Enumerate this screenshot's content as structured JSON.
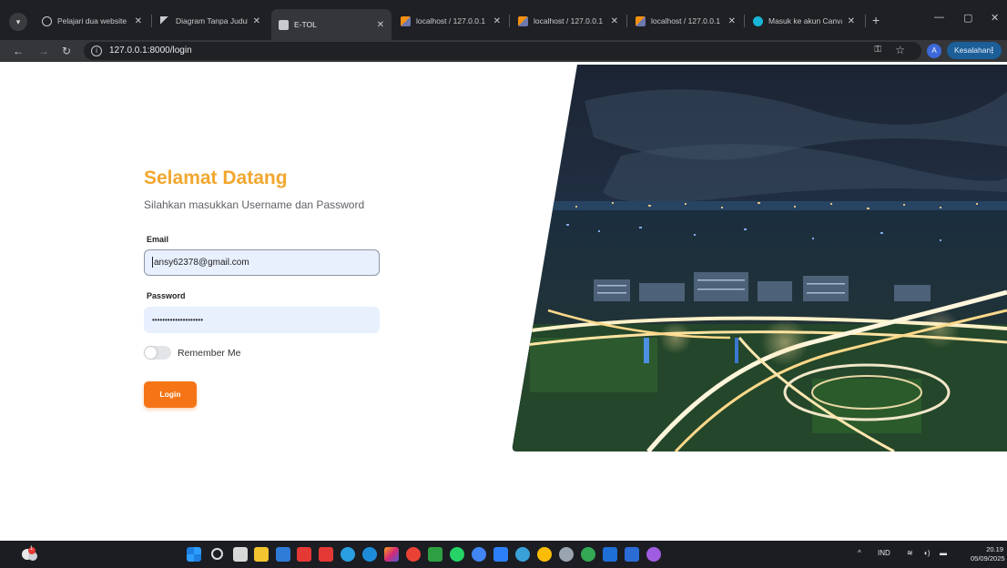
{
  "browser": {
    "tabs": [
      {
        "title": "Pelajari dua website",
        "favicon": "globe-icon",
        "active": false
      },
      {
        "title": "Diagram Tanpa Judul",
        "favicon": "diagram-icon",
        "active": false
      },
      {
        "title": "E-TOL",
        "favicon": "page-icon",
        "active": true
      },
      {
        "title": "localhost / 127.0.0.1",
        "favicon": "phpmyadmin-icon",
        "active": false
      },
      {
        "title": "localhost / 127.0.0.1",
        "favicon": "phpmyadmin-icon",
        "active": false
      },
      {
        "title": "localhost / 127.0.0.1",
        "favicon": "phpmyadmin-icon",
        "active": false
      },
      {
        "title": "Masuk ke akun Canva",
        "favicon": "canva-icon",
        "active": false
      }
    ],
    "url": "127.0.0.1:8000/login",
    "profile_initial": "A",
    "error_chip": "Kesalahan"
  },
  "login": {
    "heading": "Selamat Datang",
    "subheading": "Silahkan masukkan Username dan Password",
    "email_label": "Email",
    "email_value": "ansy62378@gmail.com",
    "password_label": "Password",
    "password_value": "••••••••••••••••••••",
    "remember_label": "Remember Me",
    "remember_checked": false,
    "login_button": "Login"
  },
  "colors": {
    "heading": "#f2a72e",
    "button": "#f57516",
    "input_bg": "#e8effd"
  },
  "taskbar": {
    "language": "IND",
    "time": "20.19",
    "date": "05/09/2025",
    "weather_badge": "1"
  }
}
